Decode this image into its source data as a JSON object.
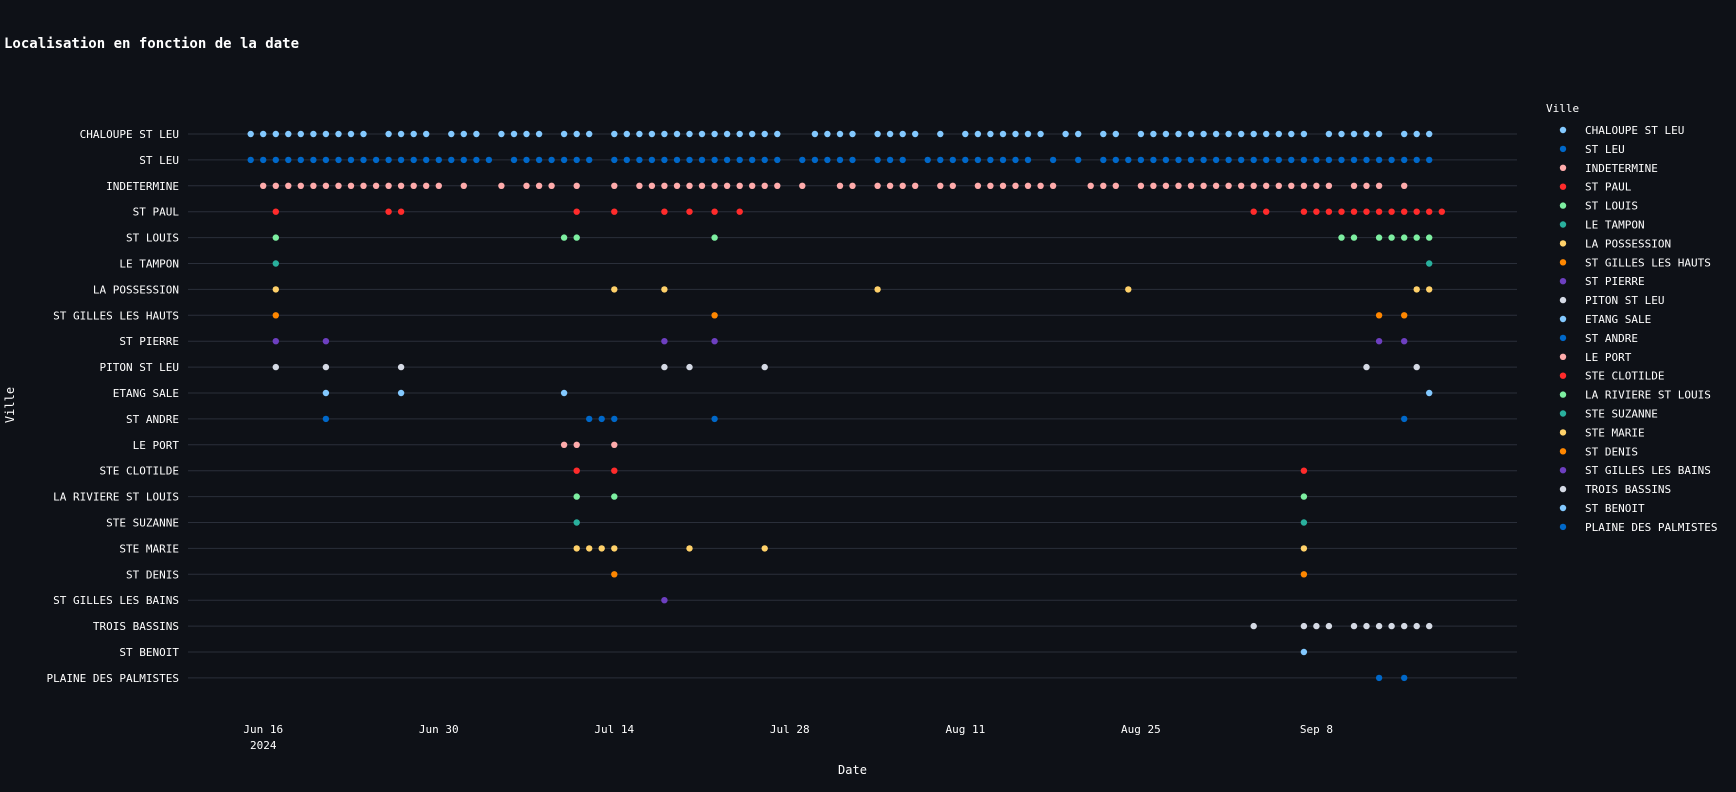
{
  "chart_data": {
    "type": "scatter",
    "title": "Localisation en fonction de la date",
    "xlabel": "Date",
    "ylabel": "Ville",
    "legend_title": "Ville",
    "legend_position": "right",
    "grid": true,
    "x_range": [
      "2024-06-10",
      "2024-09-24"
    ],
    "x_ticks": [
      {
        "date": "2024-06-16",
        "label": "Jun 16",
        "sublabel": "2024"
      },
      {
        "date": "2024-06-30",
        "label": "Jun 30",
        "sublabel": ""
      },
      {
        "date": "2024-07-14",
        "label": "Jul 14",
        "sublabel": ""
      },
      {
        "date": "2024-07-28",
        "label": "Jul 28",
        "sublabel": ""
      },
      {
        "date": "2024-08-11",
        "label": "Aug 11",
        "sublabel": ""
      },
      {
        "date": "2024-08-25",
        "label": "Aug 25",
        "sublabel": ""
      },
      {
        "date": "2024-09-08",
        "label": "Sep 8",
        "sublabel": ""
      }
    ],
    "categories": [
      "CHALOUPE ST LEU",
      "ST LEU",
      "INDETERMINE",
      "ST PAUL",
      "ST LOUIS",
      "LE TAMPON",
      "LA POSSESSION",
      "ST GILLES LES HAUTS",
      "ST PIERRE",
      "PITON ST LEU",
      "ETANG SALE",
      "ST ANDRE",
      "LE PORT",
      "STE CLOTILDE",
      "LA RIVIERE ST LOUIS",
      "STE SUZANNE",
      "STE MARIE",
      "ST DENIS",
      "ST GILLES LES BAINS",
      "TROIS BASSINS",
      "ST BENOIT",
      "PLAINE DES PALMISTES"
    ],
    "series": [
      {
        "name": "CHALOUPE ST LEU",
        "color": "#83c9ff",
        "x": [
          "2024-06-15",
          "2024-06-16",
          "2024-06-17",
          "2024-06-18",
          "2024-06-19",
          "2024-06-20",
          "2024-06-21",
          "2024-06-22",
          "2024-06-23",
          "2024-06-24",
          "2024-06-26",
          "2024-06-27",
          "2024-06-28",
          "2024-06-29",
          "2024-07-01",
          "2024-07-02",
          "2024-07-03",
          "2024-07-05",
          "2024-07-06",
          "2024-07-07",
          "2024-07-08",
          "2024-07-10",
          "2024-07-11",
          "2024-07-12",
          "2024-07-14",
          "2024-07-15",
          "2024-07-16",
          "2024-07-17",
          "2024-07-18",
          "2024-07-19",
          "2024-07-20",
          "2024-07-21",
          "2024-07-22",
          "2024-07-23",
          "2024-07-24",
          "2024-07-25",
          "2024-07-26",
          "2024-07-27",
          "2024-07-30",
          "2024-07-31",
          "2024-08-01",
          "2024-08-02",
          "2024-08-04",
          "2024-08-05",
          "2024-08-06",
          "2024-08-07",
          "2024-08-09",
          "2024-08-11",
          "2024-08-12",
          "2024-08-13",
          "2024-08-14",
          "2024-08-15",
          "2024-08-16",
          "2024-08-17",
          "2024-08-19",
          "2024-08-20",
          "2024-08-22",
          "2024-08-23",
          "2024-08-25",
          "2024-08-26",
          "2024-08-27",
          "2024-08-28",
          "2024-08-29",
          "2024-08-30",
          "2024-08-31",
          "2024-09-01",
          "2024-09-02",
          "2024-09-03",
          "2024-09-04",
          "2024-09-05",
          "2024-09-06",
          "2024-09-07",
          "2024-09-09",
          "2024-09-10",
          "2024-09-11",
          "2024-09-12",
          "2024-09-13",
          "2024-09-15",
          "2024-09-16",
          "2024-09-17"
        ]
      },
      {
        "name": "ST LEU",
        "color": "#0068c9",
        "x": [
          "2024-06-15",
          "2024-06-16",
          "2024-06-17",
          "2024-06-18",
          "2024-06-19",
          "2024-06-20",
          "2024-06-21",
          "2024-06-22",
          "2024-06-23",
          "2024-06-24",
          "2024-06-25",
          "2024-06-26",
          "2024-06-27",
          "2024-06-28",
          "2024-06-29",
          "2024-06-30",
          "2024-07-01",
          "2024-07-02",
          "2024-07-03",
          "2024-07-04",
          "2024-07-06",
          "2024-07-07",
          "2024-07-08",
          "2024-07-09",
          "2024-07-10",
          "2024-07-11",
          "2024-07-12",
          "2024-07-14",
          "2024-07-15",
          "2024-07-16",
          "2024-07-17",
          "2024-07-18",
          "2024-07-19",
          "2024-07-20",
          "2024-07-21",
          "2024-07-22",
          "2024-07-23",
          "2024-07-24",
          "2024-07-25",
          "2024-07-26",
          "2024-07-27",
          "2024-07-29",
          "2024-07-30",
          "2024-07-31",
          "2024-08-01",
          "2024-08-02",
          "2024-08-04",
          "2024-08-05",
          "2024-08-06",
          "2024-08-08",
          "2024-08-09",
          "2024-08-10",
          "2024-08-11",
          "2024-08-12",
          "2024-08-13",
          "2024-08-14",
          "2024-08-15",
          "2024-08-16",
          "2024-08-18",
          "2024-08-20",
          "2024-08-22",
          "2024-08-23",
          "2024-08-24",
          "2024-08-25",
          "2024-08-26",
          "2024-08-27",
          "2024-08-28",
          "2024-08-29",
          "2024-08-30",
          "2024-08-31",
          "2024-09-01",
          "2024-09-02",
          "2024-09-03",
          "2024-09-04",
          "2024-09-05",
          "2024-09-06",
          "2024-09-07",
          "2024-09-08",
          "2024-09-09",
          "2024-09-10",
          "2024-09-11",
          "2024-09-12",
          "2024-09-13",
          "2024-09-14",
          "2024-09-15",
          "2024-09-16",
          "2024-09-17"
        ]
      },
      {
        "name": "INDETERMINE",
        "color": "#ffabab",
        "x": [
          "2024-06-16",
          "2024-06-17",
          "2024-06-18",
          "2024-06-19",
          "2024-06-20",
          "2024-06-21",
          "2024-06-22",
          "2024-06-23",
          "2024-06-24",
          "2024-06-25",
          "2024-06-26",
          "2024-06-27",
          "2024-06-28",
          "2024-06-29",
          "2024-06-30",
          "2024-07-02",
          "2024-07-05",
          "2024-07-07",
          "2024-07-08",
          "2024-07-09",
          "2024-07-11",
          "2024-07-14",
          "2024-07-16",
          "2024-07-17",
          "2024-07-18",
          "2024-07-19",
          "2024-07-20",
          "2024-07-21",
          "2024-07-22",
          "2024-07-23",
          "2024-07-24",
          "2024-07-25",
          "2024-07-26",
          "2024-07-27",
          "2024-07-29",
          "2024-08-01",
          "2024-08-02",
          "2024-08-04",
          "2024-08-05",
          "2024-08-06",
          "2024-08-07",
          "2024-08-09",
          "2024-08-10",
          "2024-08-12",
          "2024-08-13",
          "2024-08-14",
          "2024-08-15",
          "2024-08-16",
          "2024-08-17",
          "2024-08-18",
          "2024-08-21",
          "2024-08-22",
          "2024-08-23",
          "2024-08-25",
          "2024-08-26",
          "2024-08-27",
          "2024-08-28",
          "2024-08-29",
          "2024-08-30",
          "2024-08-31",
          "2024-09-01",
          "2024-09-02",
          "2024-09-03",
          "2024-09-04",
          "2024-09-05",
          "2024-09-06",
          "2024-09-07",
          "2024-09-08",
          "2024-09-09",
          "2024-09-11",
          "2024-09-12",
          "2024-09-13",
          "2024-09-15"
        ]
      },
      {
        "name": "ST PAUL",
        "color": "#ff2b2b",
        "x": [
          "2024-06-17",
          "2024-06-26",
          "2024-06-27",
          "2024-07-11",
          "2024-07-14",
          "2024-07-18",
          "2024-07-20",
          "2024-07-22",
          "2024-07-24",
          "2024-09-03",
          "2024-09-04",
          "2024-09-07",
          "2024-09-08",
          "2024-09-09",
          "2024-09-10",
          "2024-09-11",
          "2024-09-12",
          "2024-09-13",
          "2024-09-14",
          "2024-09-15",
          "2024-09-16",
          "2024-09-17",
          "2024-09-18"
        ]
      },
      {
        "name": "ST LOUIS",
        "color": "#7defa1",
        "x": [
          "2024-06-17",
          "2024-07-10",
          "2024-07-11",
          "2024-07-22",
          "2024-09-10",
          "2024-09-11",
          "2024-09-13",
          "2024-09-14",
          "2024-09-15",
          "2024-09-16",
          "2024-09-17"
        ]
      },
      {
        "name": "LE TAMPON",
        "color": "#29b09d",
        "x": [
          "2024-06-17",
          "2024-09-17"
        ]
      },
      {
        "name": "LA POSSESSION",
        "color": "#ffd16a",
        "x": [
          "2024-06-17",
          "2024-07-14",
          "2024-07-18",
          "2024-08-04",
          "2024-08-24",
          "2024-09-16",
          "2024-09-17"
        ]
      },
      {
        "name": "ST GILLES LES HAUTS",
        "color": "#ff8700",
        "x": [
          "2024-06-17",
          "2024-07-22",
          "2024-09-13",
          "2024-09-15"
        ]
      },
      {
        "name": "ST PIERRE",
        "color": "#6d3fc0",
        "x": [
          "2024-06-17",
          "2024-06-21",
          "2024-07-18",
          "2024-07-22",
          "2024-09-13",
          "2024-09-15"
        ]
      },
      {
        "name": "PITON ST LEU",
        "color": "#d5dae5",
        "x": [
          "2024-06-17",
          "2024-06-21",
          "2024-06-27",
          "2024-07-18",
          "2024-07-20",
          "2024-07-26",
          "2024-09-12",
          "2024-09-16"
        ]
      },
      {
        "name": "ETANG SALE",
        "color": "#83c9ff",
        "x": [
          "2024-06-21",
          "2024-06-27",
          "2024-07-10",
          "2024-09-17"
        ]
      },
      {
        "name": "ST ANDRE",
        "color": "#0068c9",
        "x": [
          "2024-06-21",
          "2024-07-12",
          "2024-07-13",
          "2024-07-14",
          "2024-07-22",
          "2024-09-15"
        ]
      },
      {
        "name": "LE PORT",
        "color": "#ffabab",
        "x": [
          "2024-07-10",
          "2024-07-11",
          "2024-07-14"
        ]
      },
      {
        "name": "STE CLOTILDE",
        "color": "#ff2b2b",
        "x": [
          "2024-07-11",
          "2024-07-14",
          "2024-09-07"
        ]
      },
      {
        "name": "LA RIVIERE ST LOUIS",
        "color": "#7defa1",
        "x": [
          "2024-07-11",
          "2024-07-14",
          "2024-09-07"
        ]
      },
      {
        "name": "STE SUZANNE",
        "color": "#29b09d",
        "x": [
          "2024-07-11",
          "2024-09-07"
        ]
      },
      {
        "name": "STE MARIE",
        "color": "#ffd16a",
        "x": [
          "2024-07-11",
          "2024-07-12",
          "2024-07-13",
          "2024-07-14",
          "2024-07-20",
          "2024-07-26",
          "2024-09-07"
        ]
      },
      {
        "name": "ST DENIS",
        "color": "#ff8700",
        "x": [
          "2024-07-14",
          "2024-09-07"
        ]
      },
      {
        "name": "ST GILLES LES BAINS",
        "color": "#6d3fc0",
        "x": [
          "2024-07-18"
        ]
      },
      {
        "name": "TROIS BASSINS",
        "color": "#d5dae5",
        "x": [
          "2024-09-03",
          "2024-09-07",
          "2024-09-08",
          "2024-09-09",
          "2024-09-11",
          "2024-09-12",
          "2024-09-13",
          "2024-09-14",
          "2024-09-15",
          "2024-09-16",
          "2024-09-17"
        ]
      },
      {
        "name": "ST BENOIT",
        "color": "#83c9ff",
        "x": [
          "2024-09-07"
        ]
      },
      {
        "name": "PLAINE DES PALMISTES",
        "color": "#0068c9",
        "x": [
          "2024-09-13",
          "2024-09-15"
        ]
      }
    ]
  }
}
